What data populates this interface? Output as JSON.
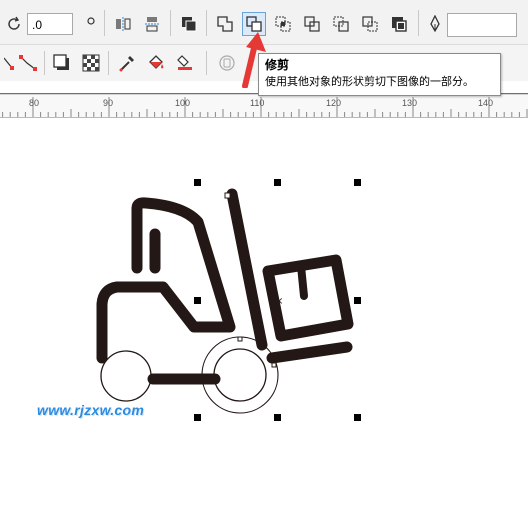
{
  "toolbar": {
    "angle_value": ".0",
    "outline_width_value": ""
  },
  "tooltip": {
    "title": "修剪",
    "description": "使用其他对象的形状剪切下图像的一部分。"
  },
  "ruler": {
    "labels": [
      "80",
      "90",
      "100",
      "110",
      "120",
      "130",
      "140"
    ]
  },
  "canvas": {
    "watermark": "www.rjzxw.com"
  },
  "colors": {
    "arrow": "#e53935",
    "artwork": "#231815",
    "ruler_accent": "#2d7fd3"
  }
}
